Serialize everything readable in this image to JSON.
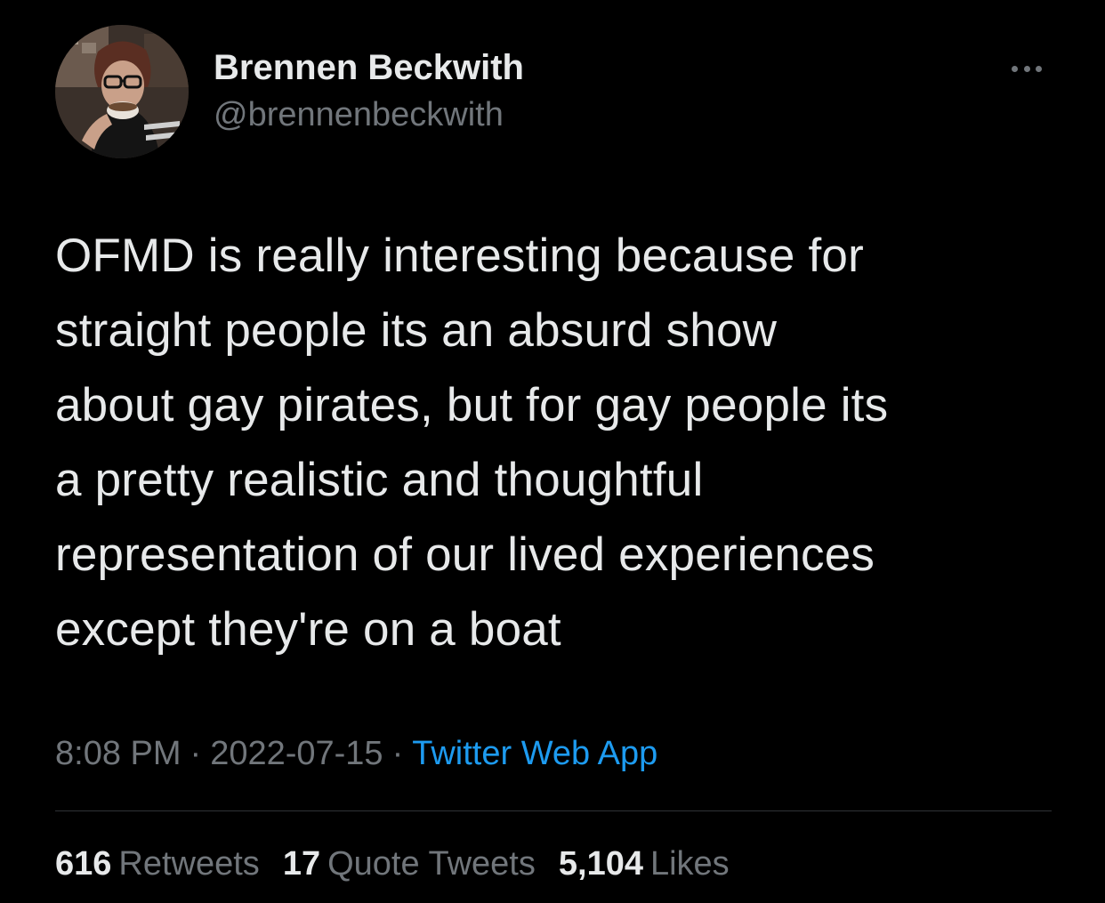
{
  "user": {
    "display_name": "Brennen Beckwith",
    "handle": "@brennenbeckwith",
    "avatar_icon": "profile-photo"
  },
  "more_icon": "ellipsis-icon",
  "tweet": {
    "text": "OFMD is really interesting because for\nstraight people its an absurd show\nabout gay pirates, but for gay people its\na pretty realistic and thoughtful\nrepresentation of our lived experiences\nexcept they're on a boat"
  },
  "meta": {
    "time": "8:08 PM",
    "date": "2022-07-15",
    "separator": "·",
    "source": "Twitter Web App"
  },
  "stats": {
    "retweets_count": "616",
    "retweets_label": "Retweets",
    "quotes_count": "17",
    "quotes_label": "Quote Tweets",
    "likes_count": "5,104",
    "likes_label": "Likes"
  },
  "colors": {
    "background": "#000000",
    "primary_text": "#e7e9ea",
    "secondary_text": "#71767b",
    "link": "#1d9bf0",
    "divider": "#2f3336"
  }
}
